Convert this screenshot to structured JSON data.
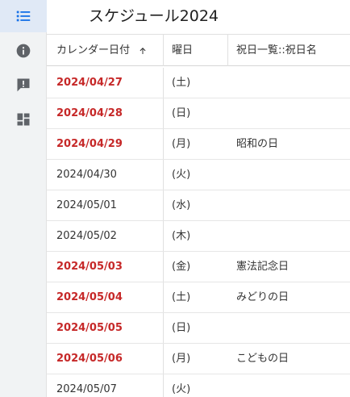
{
  "sidebar": {
    "icons": [
      {
        "name": "list-icon",
        "active": true
      },
      {
        "name": "info-icon",
        "active": false
      },
      {
        "name": "feedback-icon",
        "active": false
      },
      {
        "name": "dashboard-icon",
        "active": false
      }
    ]
  },
  "header": {
    "title": "スケジュール2024"
  },
  "table": {
    "columns": [
      "カレンダー日付",
      "曜日",
      "祝日一覧::祝日名"
    ],
    "sort_icon": "arrow-up-icon",
    "rows": [
      {
        "date": "2024/04/27",
        "dow": "(土)",
        "holiday": "",
        "highlight": true
      },
      {
        "date": "2024/04/28",
        "dow": "(日)",
        "holiday": "",
        "highlight": true
      },
      {
        "date": "2024/04/29",
        "dow": "(月)",
        "holiday": "昭和の日",
        "highlight": true
      },
      {
        "date": "2024/04/30",
        "dow": "(火)",
        "holiday": "",
        "highlight": false
      },
      {
        "date": "2024/05/01",
        "dow": "(水)",
        "holiday": "",
        "highlight": false
      },
      {
        "date": "2024/05/02",
        "dow": "(木)",
        "holiday": "",
        "highlight": false
      },
      {
        "date": "2024/05/03",
        "dow": "(金)",
        "holiday": "憲法記念日",
        "highlight": true
      },
      {
        "date": "2024/05/04",
        "dow": "(土)",
        "holiday": "みどりの日",
        "highlight": true
      },
      {
        "date": "2024/05/05",
        "dow": "(日)",
        "holiday": "",
        "highlight": true
      },
      {
        "date": "2024/05/06",
        "dow": "(月)",
        "holiday": "こどもの日",
        "highlight": true
      },
      {
        "date": "2024/05/07",
        "dow": "(火)",
        "holiday": "",
        "highlight": false
      }
    ]
  },
  "colors": {
    "holiday_red": "#c62828",
    "active_blue": "#1a73e8",
    "icon_gray": "#5f6368"
  }
}
